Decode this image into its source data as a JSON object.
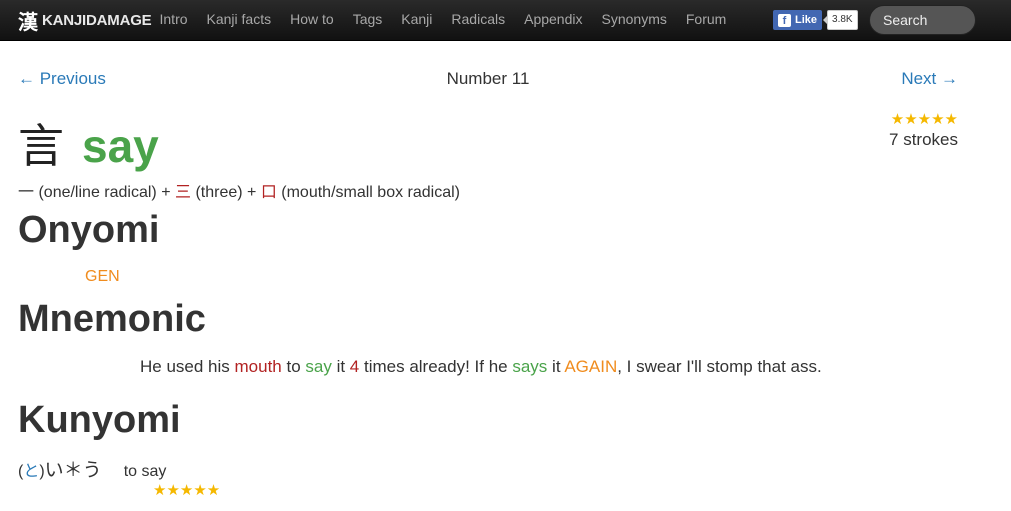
{
  "navbar": {
    "logo_glyph": "漢",
    "brand": "KANJIDAMAGE",
    "links": [
      "Intro",
      "Kanji facts",
      "How to",
      "Tags",
      "Kanji",
      "Radicals",
      "Appendix",
      "Synonyms",
      "Forum"
    ],
    "fb_icon": "f",
    "fb_like": "Like",
    "fb_count": "3.8K",
    "search_placeholder": "Search"
  },
  "pager": {
    "previous": "← Previous",
    "number": "Number 11",
    "next": "Next →"
  },
  "kanji": {
    "character": "言",
    "meaning": "say",
    "stars": "★★★★★",
    "rating": 5,
    "strokes": "7 strokes"
  },
  "components": {
    "c1_char": "一",
    "c1_desc": " (one/line radical) + ",
    "c2_char": "三",
    "c2_desc": " (three) + ",
    "c3_char": "口",
    "c3_desc": " (mouth/small box radical)"
  },
  "onyomi": {
    "heading": "Onyomi",
    "value": "GEN"
  },
  "mnemonic": {
    "heading": "Mnemonic",
    "p1": "He used his ",
    "w_mouth": "mouth",
    "p2": " to ",
    "w_say": "say",
    "p3": " it ",
    "w_four": "4",
    "p4": " times already! If he ",
    "w_says": "says",
    "p5": " it ",
    "w_again": "AGAIN",
    "p6": ", I swear I'll stomp that ass."
  },
  "kunyomi": {
    "heading": "Kunyomi",
    "paren_open": "(",
    "okurigana_prefix": "と",
    "paren_close": ")",
    "reading": "い＊う",
    "meaning": "to say",
    "stars": "★★★★★",
    "rating": 5
  },
  "colors": {
    "accent_green": "#4aa34a",
    "link_blue": "#2a7ab8",
    "radical_red": "#b22222",
    "onyomi_orange": "#f08c1e",
    "star_gold": "#f5b800"
  }
}
